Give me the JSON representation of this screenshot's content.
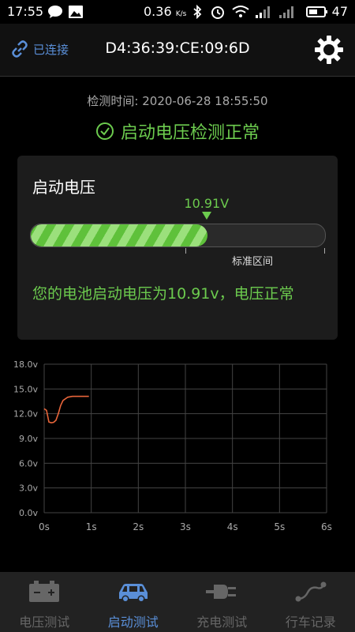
{
  "status_bar": {
    "time": "17:55",
    "speed": "0.36",
    "speed_unit": "K/s",
    "battery": "47"
  },
  "header": {
    "connection_label": "已连接",
    "device_mac": "D4:36:39:CE:09:6D"
  },
  "detect_time": "检测时间: 2020-06-28 18:55:50",
  "result_text": "启动电压检测正常",
  "card": {
    "title": "启动电压",
    "value_label": "10.91V",
    "level_fraction": 0.6,
    "standard_range_label": "标准区间",
    "message": "您的电池启动电压为10.91v，电压正常"
  },
  "chart_data": {
    "type": "line",
    "y_ticks": [
      "18.0v",
      "15.0v",
      "12.0v",
      "9.0v",
      "6.0v",
      "3.0v",
      "0.0v"
    ],
    "x_ticks": [
      "0s",
      "1s",
      "2s",
      "3s",
      "4s",
      "5s",
      "6s"
    ],
    "ylim": [
      0,
      18
    ],
    "xlim": [
      0,
      6
    ],
    "grid": true,
    "series": [
      {
        "color": "#e8653a",
        "x": [
          0.0,
          0.05,
          0.1,
          0.15,
          0.2,
          0.25,
          0.3,
          0.35,
          0.4,
          0.5,
          0.6,
          0.7,
          0.8,
          0.95
        ],
        "y": [
          12.6,
          12.4,
          11.0,
          10.9,
          10.95,
          11.2,
          12.0,
          13.0,
          13.6,
          14.0,
          14.1,
          14.1,
          14.1,
          14.1
        ]
      }
    ]
  },
  "tabs": [
    {
      "label": "电压测试",
      "icon": "battery-icon",
      "active": false
    },
    {
      "label": "启动测试",
      "icon": "car-icon",
      "active": true
    },
    {
      "label": "充电测试",
      "icon": "plug-icon",
      "active": false
    },
    {
      "label": "行车记录",
      "icon": "route-icon",
      "active": false
    }
  ],
  "colors": {
    "accent_green": "#6ccb4e",
    "accent_blue": "#5a8fd8",
    "curve": "#e8653a"
  }
}
